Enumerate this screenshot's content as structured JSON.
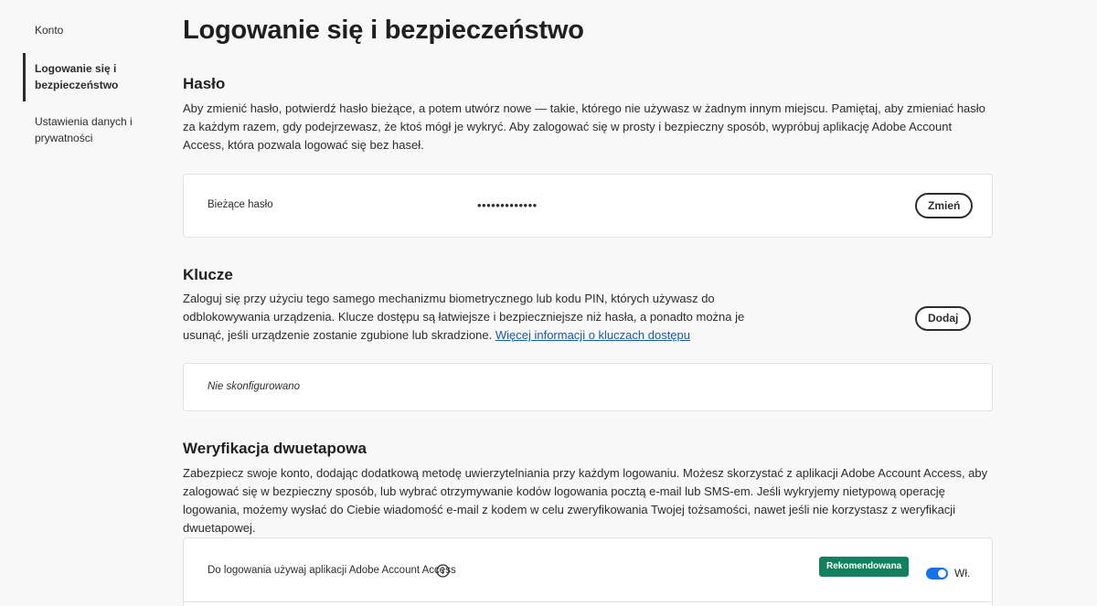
{
  "sidebar": {
    "items": [
      {
        "label": "Konto"
      },
      {
        "label": "Logowanie się i bezpieczeństwo",
        "active": true
      },
      {
        "label": "Ustawienia danych i prywatności"
      }
    ]
  },
  "page_title": "Logowanie się i bezpieczeństwo",
  "password": {
    "title": "Hasło",
    "description": "Aby zmienić hasło, potwierdź hasło bieżące, a potem utwórz nowe — takie, którego nie używasz w żadnym innym miejscu. Pamiętaj, aby zmieniać hasło za każdym razem, gdy podejrzewasz, że ktoś mógł je wykryć. Aby zalogować się w prosty i bezpieczny sposób, wypróbuj aplikację Adobe Account Access, która pozwala logować się bez haseł.",
    "field_label": "Bieżące hasło",
    "field_value": "•••••••••••••",
    "change_button": "Zmień"
  },
  "passkeys": {
    "title": "Klucze",
    "description": "Zaloguj się przy użyciu tego samego mechanizmu biometrycznego lub kodu PIN, których używasz do odblokowywania urządzenia. Klucze dostępu są łatwiejsze i bezpieczniejsze niż hasła, a ponadto można je usunąć, jeśli urządzenie zostanie zgubione lub skradzione.",
    "link": "Więcej informacji o kluczach dostępu",
    "add_button": "Dodaj",
    "status": "Nie skonfigurowano"
  },
  "two_step": {
    "title": "Weryfikacja dwuetapowa",
    "description": "Zabezpiecz swoje konto, dodając dodatkową metodę uwierzytelniania przy każdym logowaniu. Możesz skorzystać z aplikacji Adobe Account Access, aby zalogować się w bezpieczny sposób, lub wybrać otrzymywanie kodów logowania pocztą e-mail lub SMS-em. Jeśli wykryjemy nietypową operację logowania, możemy wysłać do Ciebie wiadomość e-mail z kodem w celu zweryfikowania Twojej tożsamości, nawet jeśli nie korzystasz z weryfikacji dwuetapowej.",
    "option_label": "Do logowania używaj aplikacji Adobe Account Access",
    "badge": "Rekomendowana",
    "toggle_label": "Wł.",
    "toggle_on": true,
    "info_icon": "info-icon"
  },
  "colors": {
    "accent": "#1473e6",
    "badge": "#12805c",
    "link": "#1b5aa6"
  }
}
